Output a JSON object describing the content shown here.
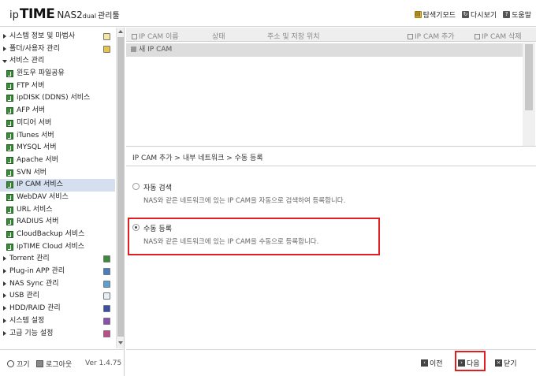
{
  "header": {
    "logo_ip": "ip",
    "logo_time": "TIME",
    "logo_nas": "NAS2",
    "logo_dual": "dual",
    "logo_admin": "관리툴",
    "links": [
      {
        "label": "탐색기모드",
        "icon": "explorer-icon"
      },
      {
        "label": "다시보기",
        "icon": "reload-icon"
      },
      {
        "label": "도움말",
        "icon": "help-icon"
      }
    ]
  },
  "sidebar": {
    "items": [
      {
        "label": "시스템 정보 및 마법사",
        "type": "top",
        "icon": "wizard-icon"
      },
      {
        "label": "폴더/사용자 관리",
        "type": "top",
        "icon": "folder-user-icon"
      },
      {
        "label": "서비스 관리",
        "type": "top-open"
      },
      {
        "label": "윈도우 파일공유",
        "type": "sub"
      },
      {
        "label": "FTP 서버",
        "type": "sub"
      },
      {
        "label": "ipDISK (DDNS) 서비스",
        "type": "sub"
      },
      {
        "label": "AFP 서버",
        "type": "sub"
      },
      {
        "label": "미디어 서버",
        "type": "sub"
      },
      {
        "label": "iTunes 서버",
        "type": "sub"
      },
      {
        "label": "MYSQL 서버",
        "type": "sub"
      },
      {
        "label": "Apache 서버",
        "type": "sub"
      },
      {
        "label": "SVN 서버",
        "type": "sub"
      },
      {
        "label": "IP CAM 서비스",
        "type": "sub",
        "selected": true
      },
      {
        "label": "WebDAV 서비스",
        "type": "sub"
      },
      {
        "label": "URL 서비스",
        "type": "sub"
      },
      {
        "label": "RADIUS 서버",
        "type": "sub"
      },
      {
        "label": "CloudBackup 서비스",
        "type": "sub"
      },
      {
        "label": "ipTIME Cloud 서비스",
        "type": "sub"
      },
      {
        "label": "Torrent 관리",
        "type": "top",
        "icon": "torrent-icon"
      },
      {
        "label": "Plug-in APP 관리",
        "type": "top",
        "icon": "plugin-icon"
      },
      {
        "label": "NAS Sync 관리",
        "type": "top",
        "icon": "sync-icon"
      },
      {
        "label": "USB 관리",
        "type": "top",
        "icon": "usb-icon"
      },
      {
        "label": "HDD/RAID 관리",
        "type": "top",
        "icon": "hdd-icon"
      },
      {
        "label": "시스템 설정",
        "type": "top",
        "icon": "system-settings-icon"
      },
      {
        "label": "고급 기능 설정",
        "type": "top",
        "icon": "advanced-settings-icon"
      }
    ],
    "footer": {
      "power_label": "끄기",
      "logout_label": "로그아웃",
      "version": "Ver 1.4.75"
    }
  },
  "camlist": {
    "columns": [
      "IP CAM 이름",
      "상태",
      "주소 및 저장 위치"
    ],
    "add_label": "IP CAM 추가",
    "delete_label": "IP CAM 삭제",
    "rows": [
      "새 IP CAM"
    ]
  },
  "wizard": {
    "breadcrumb": "IP CAM 추가 > 내부 네트워크 > 수동 등록",
    "options": [
      {
        "title": "자동 검색",
        "desc": "NAS와 같은 네트워크에 있는 IP CAM을 자동으로 검색하여 등록합니다.",
        "selected": false
      },
      {
        "title": "수동 등록",
        "desc": "NAS와 같은 네트워크에 있는 IP CAM을 수동으로 등록합니다.",
        "selected": true
      }
    ]
  },
  "nav": {
    "prev_label": "이전",
    "next_label": "다음",
    "close_label": "닫기"
  },
  "colors": {
    "selected_bg": "#d5dff0",
    "highlight": "#e02020",
    "service_icon": "#3b8b3b"
  }
}
